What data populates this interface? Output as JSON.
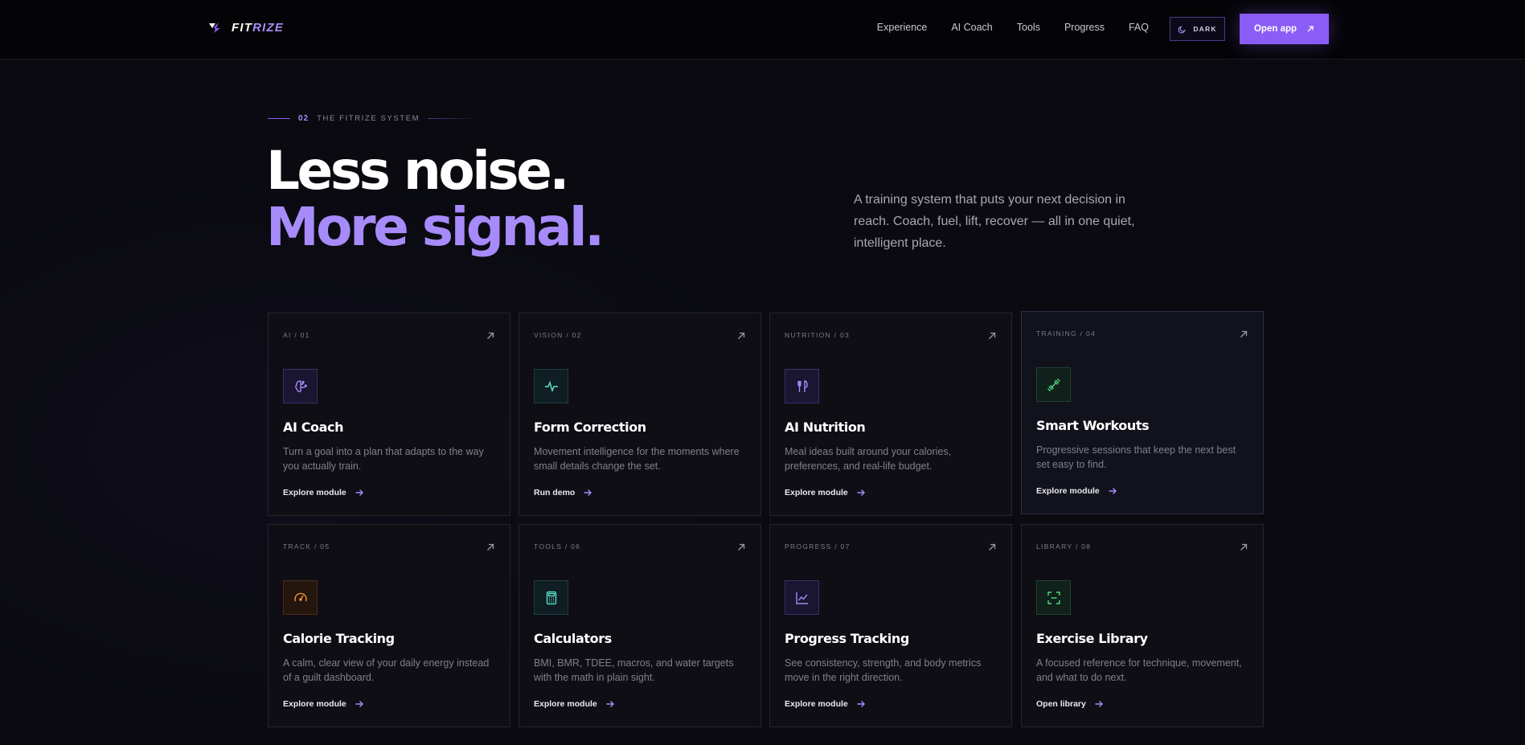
{
  "brand": {
    "name_a": "FIT",
    "name_b": "RIZE"
  },
  "nav": {
    "links": [
      "Experience",
      "AI Coach",
      "Tools",
      "Progress",
      "FAQ"
    ],
    "theme_label": "DARK",
    "cta_label": "Open app"
  },
  "hero": {
    "eyebrow_num": "02",
    "eyebrow_label": "THE FITRIZE SYSTEM",
    "title_line1": "Less noise.",
    "title_line2": "More signal.",
    "description": "A training system that puts your next decision in reach. Coach, fuel, lift, recover — all in one quiet, intelligent place."
  },
  "colors": {
    "accent": "#8b5cf6",
    "accent_text": "#a78bfa",
    "teal": "#5eead4",
    "green": "#4ade80",
    "orange": "#fb923c"
  },
  "cards": [
    {
      "tag": "AI / 01",
      "title": "AI Coach",
      "desc": "Turn a goal into a plan that adapts to the way you actually train.",
      "cta": "Explore module",
      "icon": "brain-icon"
    },
    {
      "tag": "VISION / 02",
      "title": "Form Correction",
      "desc": "Movement intelligence for the moments where small details change the set.",
      "cta": "Run demo",
      "icon": "activity-icon"
    },
    {
      "tag": "NUTRITION / 03",
      "title": "AI Nutrition",
      "desc": "Meal ideas built around your calories, preferences, and real-life budget.",
      "cta": "Explore module",
      "icon": "utensils-icon"
    },
    {
      "tag": "TRAINING / 04",
      "title": "Smart Workouts",
      "desc": "Progressive sessions that keep the next best set easy to find.",
      "cta": "Explore module",
      "icon": "dumbbell-icon"
    },
    {
      "tag": "TRACK / 05",
      "title": "Calorie Tracking",
      "desc": "A calm, clear view of your daily energy instead of a guilt dashboard.",
      "cta": "Explore module",
      "icon": "gauge-icon"
    },
    {
      "tag": "TOOLS / 06",
      "title": "Calculators",
      "desc": "BMI, BMR, TDEE, macros, and water targets with the math in plain sight.",
      "cta": "Explore module",
      "icon": "calculator-icon"
    },
    {
      "tag": "PROGRESS / 07",
      "title": "Progress Tracking",
      "desc": "See consistency, strength, and body metrics move in the right direction.",
      "cta": "Explore module",
      "icon": "chart-icon"
    },
    {
      "tag": "LIBRARY / 08",
      "title": "Exercise Library",
      "desc": "A focused reference for technique, movement, and what to do next.",
      "cta": "Open library",
      "icon": "scan-icon"
    }
  ]
}
